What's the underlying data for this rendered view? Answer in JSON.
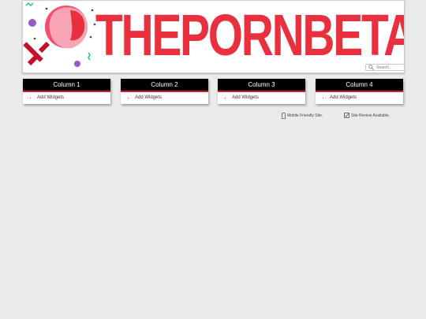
{
  "header": {
    "logo_text": "THEPORNBETA",
    "search_placeholder": "Search..."
  },
  "columns": [
    {
      "title": "Column 1",
      "item": "Add Widgets"
    },
    {
      "title": "Column 2",
      "item": "Add Widgets"
    },
    {
      "title": "Column 3",
      "item": "Add Widgets"
    },
    {
      "title": "Column 4",
      "item": "Add Widgets"
    }
  ],
  "footer": {
    "mobile_note": "Mobile Friendly Site.",
    "review_note": "Site Review Available."
  },
  "colors": {
    "brand_red": "#e8303f",
    "logo_pink": "#f0506e",
    "header_black": "#000000",
    "accent_red": "#d71d2a"
  },
  "icons": [
    "mobile-icon",
    "checkbox-icon",
    "search-icon",
    "venus-symbol-icon"
  ]
}
